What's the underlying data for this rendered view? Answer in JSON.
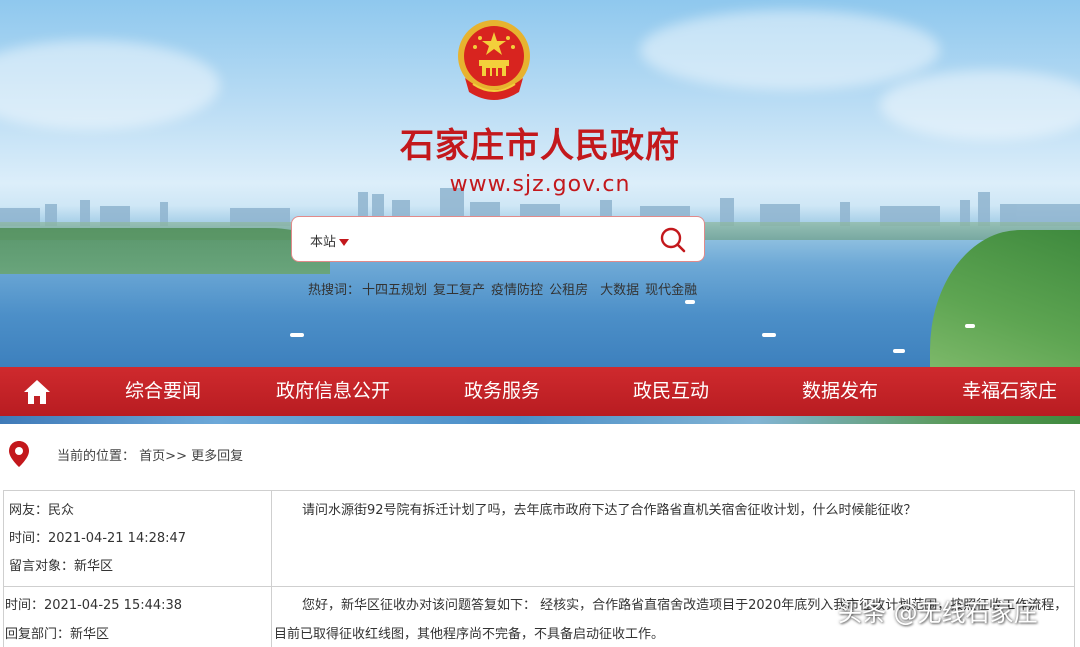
{
  "header": {
    "site_title": "石家庄市人民政府",
    "site_url": "www.sjz.gov.cn"
  },
  "search": {
    "scope_label": "本站",
    "placeholder": ""
  },
  "hot_words": {
    "label": "热搜词：",
    "items": [
      "十四五规划",
      "复工复产",
      "疫情防控",
      "公租房",
      "大数据",
      "现代金融"
    ]
  },
  "nav": {
    "items": [
      "综合要闻",
      "政府信息公开",
      "政务服务",
      "政民互动",
      "数据发布",
      "幸福石家庄"
    ]
  },
  "breadcrumb": {
    "prefix": "当前的位置：",
    "home": "首页",
    "sep": ">>",
    "current": "更多回复"
  },
  "message": {
    "netizen": "网友：民众",
    "ask_time": "时间：2021-04-21 14:28:47",
    "target": "留言对象：新华区",
    "question": "请问水源街92号院有拆迁计划了吗，去年底市政府下达了合作路省直机关宿舍征收计划，什么时候能征收？",
    "reply_time": "时间：2021-04-25 15:44:38",
    "reply_dept": "回复部门：新华区",
    "reply_line1": "您好，新华区征收办对该问题答复如下： 经核实，合作路省直宿舍改造项目于2020年底列入我市征收计划范围，按照征收工作流程，",
    "reply_line2": "目前已取得征收红线图，其他程序尚不完备，不具备启动征收工作。"
  },
  "watermark": "头条 @无线石家庄",
  "colors": {
    "brand_red": "#c3181c",
    "nav_red": "#c5222a"
  },
  "icons": {
    "home": "home-icon",
    "search": "search-icon",
    "location": "location-pin-icon",
    "emblem": "national-emblem-icon"
  }
}
